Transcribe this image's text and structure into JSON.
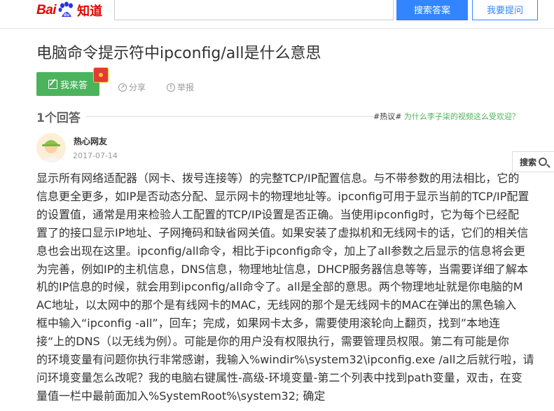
{
  "header": {
    "logo_bai": "Bai",
    "logo_zhidao": "知道",
    "search_button": "搜索答案",
    "ask_button": "我要提问",
    "brand_color": "#e10601",
    "accent_color": "#3385ff"
  },
  "question": {
    "title": "电脑命令提示符中ipconfig/all是什么意思"
  },
  "actions": {
    "answer_button": "我来答",
    "share": "分享",
    "report": "举报",
    "answer_color": "#4cb35d"
  },
  "answers": {
    "count_label": "1个回答",
    "hot_tag": "#热议#",
    "hot_link": "为什么李子柒的视频这么受欢迎？"
  },
  "answer": {
    "user_name": "热心网友",
    "date": "2017-07-14",
    "lines": [
      "显示所有网络适配器（网卡、拨号连接等）的完整TCP/IP配置信息。与不带参数的用法相比，它的",
      "信息更全更多，如IP是否动态分配、显示网卡的物理地址等。ipconfig可用于显示当前的TCP/IP配置",
      "的设置值，通常是用来检验人工配置的TCP/IP设置是否正确。当使用ipconfig时，它为每个已经配",
      "置了的接口显示IP地址、子网掩码和缺省网关值。如果安装了虚拟机和无线网卡的话，它们的相关信",
      "息也会出现在这里。ipconfig/all命令，相比于ipconfig命令，加上了all参数之后显示的信息将会更",
      "为完善，例如IP的主机信息，DNS信息，物理地址信息，DHCP服务器信息等等，当需要详细了解本",
      "机的IP信息的时候，就会用到ipconfig/all命令了。all是全部的意思。两个物理地址就是你电脑的M",
      "AC地址，以太网中的那个是有线网卡的MAC，无线网的那个是无线网卡的MAC在弹出的黑色输入",
      "框中输入“ipconfig -all”，回车；完成，如果网卡太多，需要使用滚轮向上翻页，找到”本地连",
      "接“上的DNS（以无线为例）。可能是你的用户没有权限执行，需要管理员权限。第二有可能是你",
      "的环境变量有问题你执行非常感谢，我输入%windir%\\system32\\ipconfig.exe /all之后就行啦，请",
      "问环境变量怎么改呢？我的电脑右键属性-高级-环境变量-第二个列表中找到path变量，双击，在变",
      "量值一栏中最前面加入%SystemRoot%\\system32; 确定"
    ]
  },
  "side": {
    "search_label": "搜索"
  }
}
